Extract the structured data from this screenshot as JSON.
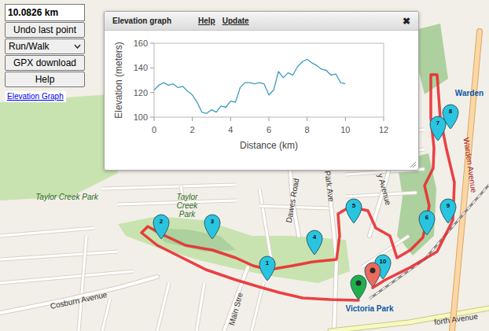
{
  "control_panel": {
    "distance": "10.0826 km",
    "buttons": [
      {
        "label": "Undo last point",
        "kind": "button"
      },
      {
        "label": "Run/Walk",
        "kind": "select"
      },
      {
        "label": "GPX download",
        "kind": "button"
      },
      {
        "label": "Help",
        "kind": "button"
      }
    ],
    "link": "Elevation Graph"
  },
  "elevation_window": {
    "title": "Elevation graph",
    "links": [
      "Help",
      "Update"
    ],
    "close": "✖",
    "chart": {
      "y_axis_title": "Elevation (meters)",
      "x_axis_title": "Distance (km)",
      "y_ticks": [
        "160",
        "140",
        "120",
        "100"
      ],
      "x_ticks": [
        "0",
        "2",
        "4",
        "6",
        "8",
        "10",
        "12"
      ],
      "series": [
        {
          "distance_km": [
            0,
            0.25,
            0.5,
            0.75,
            1,
            1.25,
            1.5,
            1.75,
            2,
            2.25,
            2.5,
            2.75,
            3,
            3.25,
            3.5,
            3.75,
            4,
            4.25,
            4.5,
            4.75,
            5,
            5.25,
            5.5,
            5.75,
            6,
            6.25,
            6.5,
            6.75,
            7,
            7.25,
            7.5,
            7.75,
            8,
            8.25,
            8.5,
            8.75,
            9,
            9.25,
            9.5,
            9.75,
            10
          ],
          "elevation_m": [
            122,
            126,
            128,
            126,
            127,
            124,
            125,
            121,
            118,
            112,
            104,
            103,
            106,
            104,
            109,
            108,
            113,
            112,
            124,
            128,
            128,
            127,
            128,
            127,
            118,
            122,
            137,
            132,
            136,
            134,
            141,
            145,
            147,
            144,
            142,
            139,
            138,
            134,
            135,
            128,
            127
          ]
        }
      ]
    }
  },
  "map": {
    "labels": [
      {
        "text": "Taylor Creek Park",
        "kind": "park"
      },
      {
        "text": "Taylor Creek Park",
        "kind": "park"
      },
      {
        "text": "Cosburn Avenue",
        "kind": "street"
      },
      {
        "text": "Dawes Road",
        "kind": "street"
      },
      {
        "text": "ria Park Ave",
        "kind": "street"
      },
      {
        "text": "y Avenue",
        "kind": "street"
      },
      {
        "text": "Main Stre",
        "kind": "street"
      },
      {
        "text": "Victoria Park",
        "kind": "station"
      },
      {
        "text": "Warden",
        "kind": "station"
      },
      {
        "text": "Warden Avenue",
        "kind": "highway"
      },
      {
        "text": "forth Avenue",
        "kind": "street"
      }
    ],
    "markers": [
      {
        "label": "1",
        "kind": "waypoint",
        "color": "#29c4e0"
      },
      {
        "label": "2",
        "kind": "waypoint",
        "color": "#29c4e0"
      },
      {
        "label": "3",
        "kind": "waypoint",
        "color": "#29c4e0"
      },
      {
        "label": "4",
        "kind": "waypoint",
        "color": "#29c4e0"
      },
      {
        "label": "5",
        "kind": "waypoint",
        "color": "#29c4e0"
      },
      {
        "label": "6",
        "kind": "waypoint",
        "color": "#29c4e0"
      },
      {
        "label": "7",
        "kind": "waypoint",
        "color": "#29c4e0"
      },
      {
        "label": "8",
        "kind": "waypoint",
        "color": "#29c4e0"
      },
      {
        "label": "9",
        "kind": "waypoint",
        "color": "#29c4e0"
      },
      {
        "label": "10",
        "kind": "waypoint",
        "color": "#29c4e0"
      },
      {
        "label": "",
        "kind": "start",
        "color": "#1fb04a"
      },
      {
        "label": "",
        "kind": "end",
        "color": "#ec6a5e"
      }
    ]
  }
}
